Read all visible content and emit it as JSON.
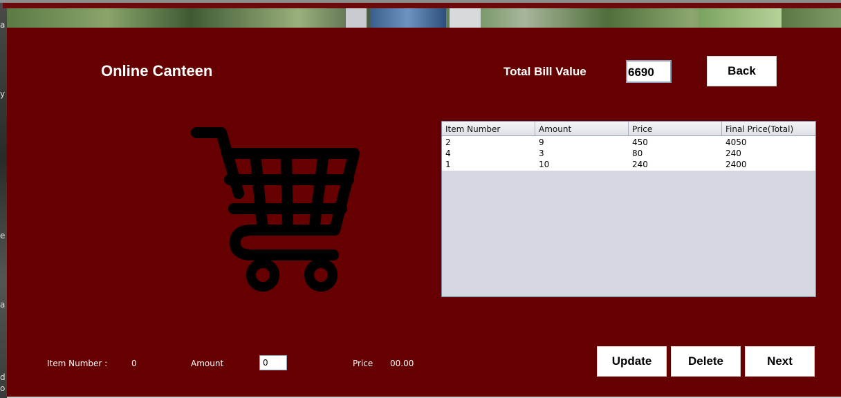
{
  "window": {
    "left_edge_fragments": [
      "a",
      "y",
      "e",
      "a",
      "d",
      "o"
    ]
  },
  "header": {
    "title": "Online Canteen",
    "total_bill_label": "Total Bill Value",
    "total_bill_value": "6690",
    "back_label": "Back"
  },
  "cart": {
    "icon": "shopping-cart-icon"
  },
  "table": {
    "columns": [
      "Item Number",
      "Amount",
      "Price",
      "Final Price(Total)"
    ],
    "rows": [
      [
        "2",
        "9",
        "450",
        "4050"
      ],
      [
        "4",
        "3",
        "80",
        "240"
      ],
      [
        "1",
        "10",
        "240",
        "2400"
      ]
    ]
  },
  "form": {
    "item_number_label": "Item Number :",
    "item_number_value": "0",
    "amount_label": "Amount",
    "amount_value": "0",
    "price_label": "Price",
    "price_value": "00.00"
  },
  "actions": {
    "update_label": "Update",
    "delete_label": "Delete",
    "next_label": "Next"
  },
  "colors": {
    "background": "#660000",
    "button_bg": "#ffffff",
    "text": "#ffffff"
  }
}
